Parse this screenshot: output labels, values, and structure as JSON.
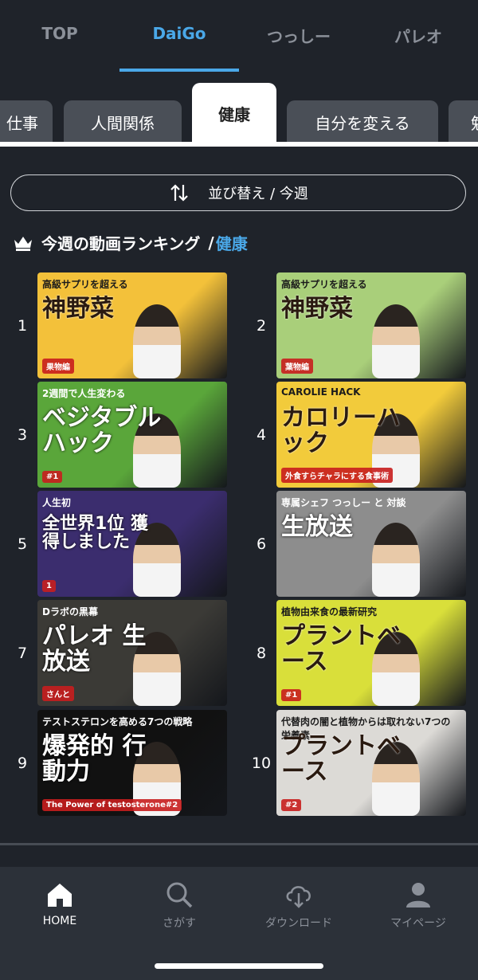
{
  "top_tabs": [
    "TOP",
    "DaiGo",
    "つっしー",
    "パレオ"
  ],
  "category_tabs": [
    "仕事",
    "人間関係",
    "健康",
    "自分を変える",
    "勉"
  ],
  "sort": {
    "label": "並び替え / 今週"
  },
  "ranking": {
    "title": "今週の動画ランキング",
    "separator": "/",
    "category": "健康"
  },
  "videos": [
    {
      "rank": "1",
      "line1": "高級サプリを超える",
      "line2": "神野菜",
      "badge": "果物編",
      "bg": "#f3c13a"
    },
    {
      "rank": "2",
      "line1": "高級サプリを超える",
      "line2": "神野菜",
      "badge": "葉物編",
      "bg": "#a9cf7a"
    },
    {
      "rank": "3",
      "line1": "2週間で人生変わる",
      "line2": "ベジタブルハック",
      "badge": "#1",
      "bg": "#5aa63a"
    },
    {
      "rank": "4",
      "line1": "CAROLIE HACK",
      "line2": "カロリーハック",
      "badge": "外食すらチャラにする食事術",
      "bg": "#f2cb3b"
    },
    {
      "rank": "5",
      "line1": "人生初",
      "line2": "全世界1位 獲得しました",
      "badge": "1",
      "bg": "#3b2d6e"
    },
    {
      "rank": "6",
      "line1": "専属シェフ つっしー と 対談",
      "line2": "生放送",
      "badge": "",
      "bg": "#8d8d8d"
    },
    {
      "rank": "7",
      "line1": "Dラボの黒幕",
      "line2": "パレオ 生放送",
      "badge": "さんと",
      "bg": "#3b3a36"
    },
    {
      "rank": "8",
      "line1": "植物由来食の最新研究",
      "line2": "プラントベース",
      "badge": "#1",
      "bg": "#d9df3a"
    },
    {
      "rank": "9",
      "line1": "テストステロンを高める7つの戦略",
      "line2": "爆発的 行動力",
      "badge": "The Power of testosterone#2",
      "bg": "#111111"
    },
    {
      "rank": "10",
      "line1": "代替肉の闇と植物からは取れない7つの栄養素",
      "line2": "プラントベース",
      "badge": "#2",
      "bg": "#dcdad6"
    }
  ],
  "bottom_nav": [
    "HOME",
    "さがす",
    "ダウンロード",
    "マイページ"
  ],
  "colors": {
    "accent": "#4aa8e8",
    "background": "#1f232a",
    "tab_inactive": "#4a4f57"
  },
  "icons": {
    "sort": "sort-arrows-icon",
    "ranking": "crown-icon",
    "home": "home-icon",
    "search": "search-icon",
    "download": "cloud-download-icon",
    "mypage": "person-icon"
  }
}
